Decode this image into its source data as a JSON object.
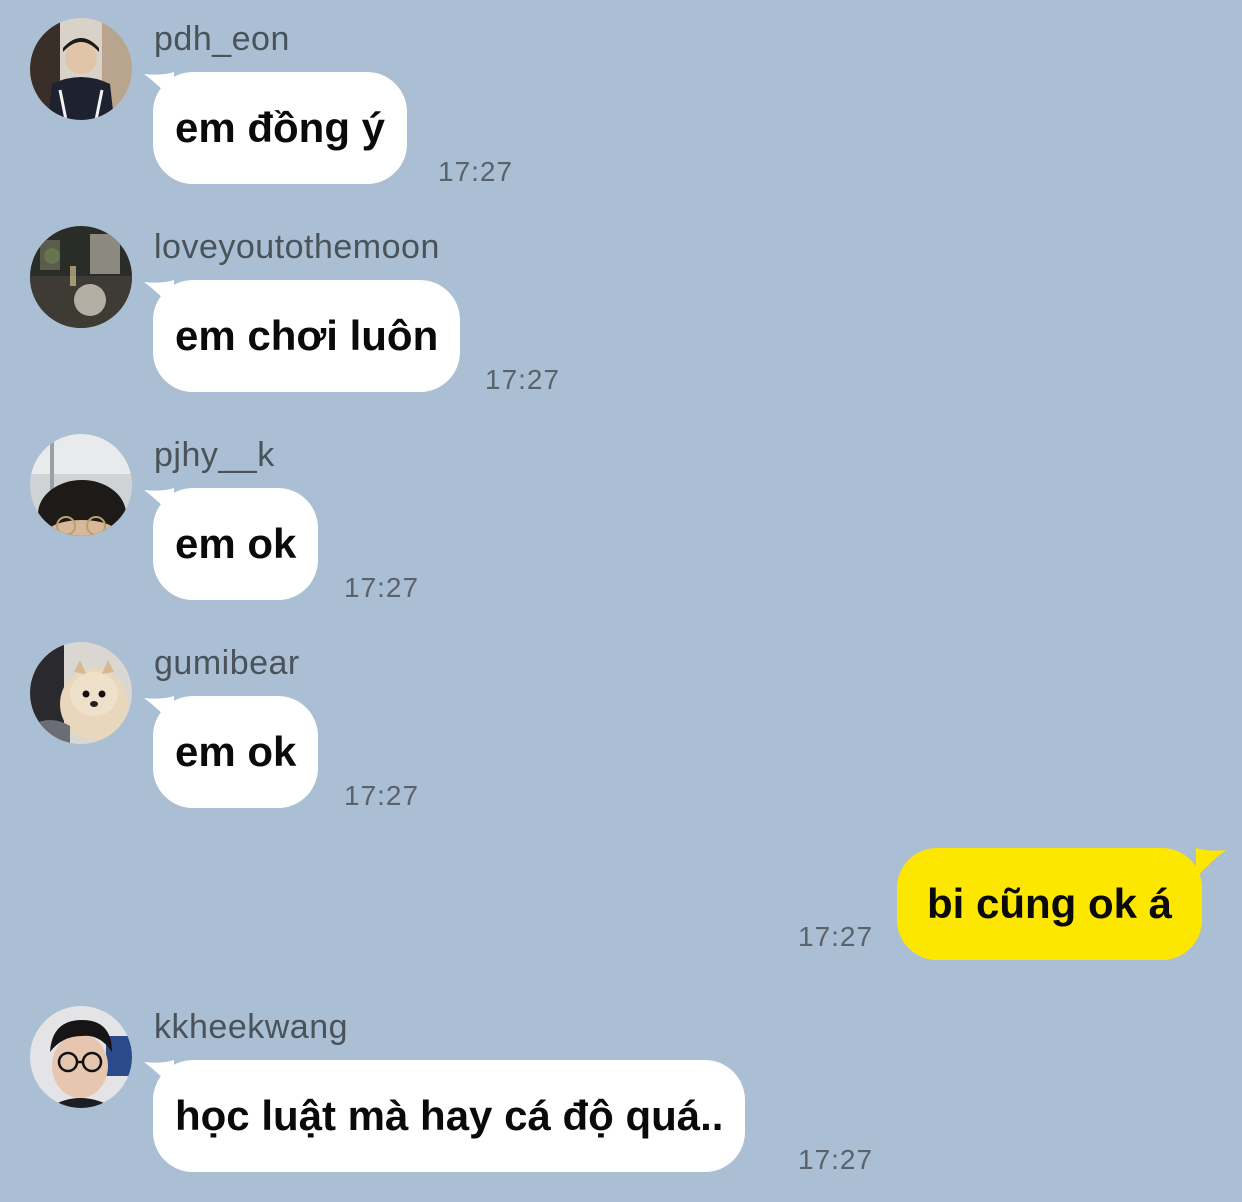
{
  "colors": {
    "background": "#aabfd3",
    "incoming_bubble": "#ffffff",
    "outgoing_bubble": "#fde600",
    "sender_name": "#4a525a",
    "timestamp": "#5a636c"
  },
  "messages": [
    {
      "sender": "pdh_eon",
      "text": "em đồng ý",
      "time": "17:27",
      "avatar": "avatar-photo-person-jacket",
      "outgoing": false
    },
    {
      "sender": "loveyoutothemoon",
      "text": "em chơi luôn",
      "time": "17:27",
      "avatar": "avatar-photo-night-street",
      "outgoing": false
    },
    {
      "sender": "pjhy__k",
      "text": "em ok",
      "time": "17:27",
      "avatar": "avatar-photo-person-glasses",
      "outgoing": false
    },
    {
      "sender": "gumibear",
      "text": "em ok",
      "time": "17:27",
      "avatar": "avatar-photo-pomeranian",
      "outgoing": false
    },
    {
      "sender": "",
      "text": "bi cũng ok á",
      "time": "17:27",
      "avatar": "",
      "outgoing": true
    },
    {
      "sender": "kkheekwang",
      "text": "học luật mà hay cá độ quá..",
      "time": "17:27",
      "avatar": "avatar-photo-selfie-glasses",
      "outgoing": false
    }
  ]
}
